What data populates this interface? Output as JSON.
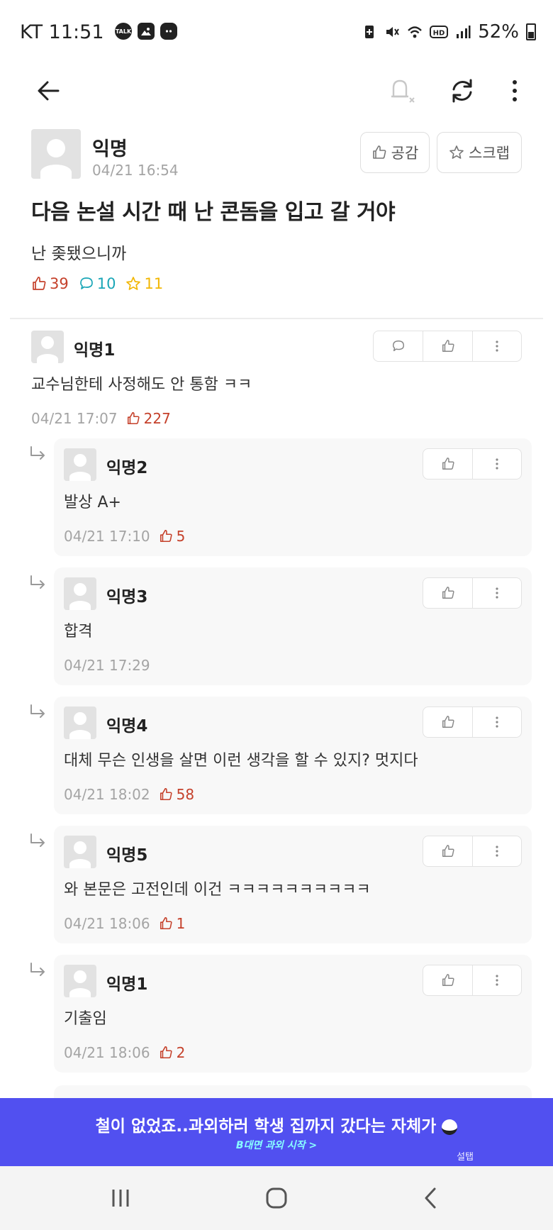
{
  "status_bar": {
    "carrier_time": "KT 11:51",
    "notification_icons": [
      "talk-icon",
      "gallery-icon",
      "discord-icon"
    ],
    "battery": "52%",
    "status_icons": [
      "battery-saver-icon",
      "mute-vibrate-icon",
      "wifi-icon",
      "hd-icon",
      "signal-icon"
    ]
  },
  "toolbar": {
    "back_icon": "arrow-left-icon",
    "notify_icon": "bell-off-icon",
    "refresh_icon": "refresh-icon",
    "more_icon": "more-vertical-icon"
  },
  "post": {
    "author": "익명",
    "time": "04/21 16:54",
    "like_button": "공감",
    "scrap_button": "스크랩",
    "title": "다음 논설 시간 때 난 콘돔을 입고 갈 거야",
    "body": "난 좆됐으니까",
    "likes": "39",
    "comments": "10",
    "scraps": "11"
  },
  "comments": [
    {
      "author": "익명1",
      "body": "교수님한테 사정해도 안 통함 ㅋㅋ",
      "time": "04/21 17:07",
      "likes": "227"
    }
  ],
  "replies": [
    {
      "author": "익명2",
      "body": "발상 A+",
      "time": "04/21 17:10",
      "likes": "5"
    },
    {
      "author": "익명3",
      "body": "합격",
      "time": "04/21 17:29",
      "likes": ""
    },
    {
      "author": "익명4",
      "body": "대체 무슨 인생을 살면 이런 생각을 할 수 있지? 멋지다",
      "time": "04/21 18:02",
      "likes": "58"
    },
    {
      "author": "익명5",
      "body": "와 본문은 고전인데 이건 ㅋㅋㅋㅋㅋㅋㅋㅋㅋㅋ",
      "time": "04/21 18:06",
      "likes": "1"
    },
    {
      "author": "익명1",
      "body": "기출임",
      "time": "04/21 18:06",
      "likes": "2"
    }
  ],
  "ad": {
    "text": "철이 없었죠..과외하러 학생 집까지 갔다는 자체가",
    "subtext": "B대면 과외 시작 >",
    "brand": "설탭"
  },
  "colors": {
    "like": "#c5412b",
    "comment": "#1aa6b7",
    "scrap": "#f2b705",
    "ad_bg": "#5150f0",
    "timestamp": "#a4a4a4"
  }
}
